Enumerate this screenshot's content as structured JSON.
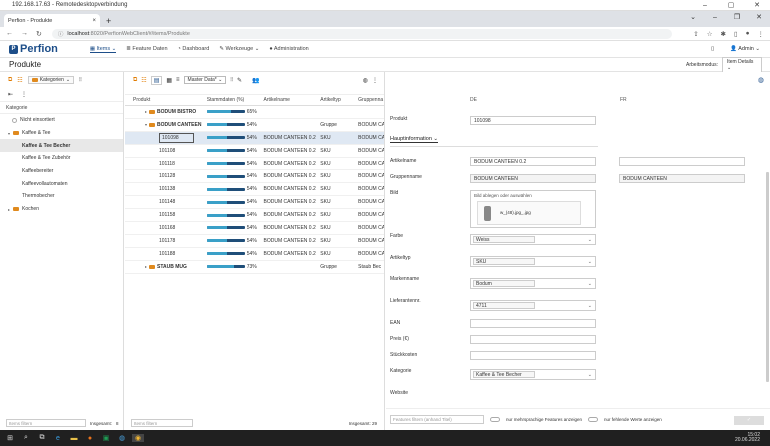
{
  "rdp": {
    "title": "192.168.17.63 - Remotedesktopverbindung"
  },
  "browser": {
    "tab_title": "Perfion - Produkte",
    "url_host": "localhost",
    "url_rest": ":8020/PerfionWebClient/#/items/Produkte"
  },
  "app": {
    "logo": "Perfion",
    "nav": [
      "Items",
      "Feature Daten",
      "Dashboard",
      "Werkzeuge",
      "Administration"
    ],
    "admin": "Admin"
  },
  "page": {
    "title": "Produkte",
    "mode_label": "Arbeitsmodus:",
    "mode_value": "Item Details"
  },
  "left": {
    "kategorien": "Kategorien",
    "header": "Kategorie",
    "tree": [
      {
        "label": "Nicht einsortiert",
        "level": 0,
        "kind": "none"
      },
      {
        "label": "Kaffee & Tee",
        "level": 0,
        "kind": "folder-open"
      },
      {
        "label": "Kaffee & Tee Becher",
        "level": 1,
        "kind": "leaf",
        "selected": true
      },
      {
        "label": "Kaffee & Tee Zubehör",
        "level": 1,
        "kind": "leaf"
      },
      {
        "label": "Kaffeebereiter",
        "level": 1,
        "kind": "leaf"
      },
      {
        "label": "Kaffeevollautomaten",
        "level": 1,
        "kind": "leaf"
      },
      {
        "label": "Thermobecher",
        "level": 1,
        "kind": "leaf"
      },
      {
        "label": "Kochen",
        "level": 0,
        "kind": "folder"
      }
    ],
    "filter_placeholder": "Items filtern",
    "count_label": "Insgesamt:",
    "count_value": "8"
  },
  "mid": {
    "view": "Master Data*",
    "headers": [
      "Produkt",
      "Stammdaten (%)",
      "Artikelname",
      "Artikeltyp",
      "Gruppenna"
    ],
    "rows": [
      {
        "name": "BODUM BISTRO",
        "pct": 65,
        "pct_label": "65%",
        "artikel": "",
        "typ": "",
        "gruppe": "",
        "kind": "group"
      },
      {
        "name": "BODUM CANTEEN",
        "pct": 54,
        "pct_label": "54%",
        "artikel": "",
        "typ": "Gruppe",
        "gruppe": "BODUM CA",
        "kind": "group-open"
      },
      {
        "name": "101098",
        "pct": 54,
        "pct_label": "54%",
        "artikel": "BODUM CANTEEN 0.2",
        "typ": "SKU",
        "gruppe": "BODUM CA",
        "kind": "item",
        "selected": true
      },
      {
        "name": "101108",
        "pct": 54,
        "pct_label": "54%",
        "artikel": "BODUM CANTEEN 0.2",
        "typ": "SKU",
        "gruppe": "BODUM CA",
        "kind": "item"
      },
      {
        "name": "101118",
        "pct": 54,
        "pct_label": "54%",
        "artikel": "BODUM CANTEEN 0.2",
        "typ": "SKU",
        "gruppe": "BODUM CA",
        "kind": "item"
      },
      {
        "name": "101128",
        "pct": 54,
        "pct_label": "54%",
        "artikel": "BODUM CANTEEN 0.2",
        "typ": "SKU",
        "gruppe": "BODUM CA",
        "kind": "item"
      },
      {
        "name": "101138",
        "pct": 54,
        "pct_label": "54%",
        "artikel": "BODUM CANTEEN 0.2",
        "typ": "SKU",
        "gruppe": "BODUM CA",
        "kind": "item"
      },
      {
        "name": "101148",
        "pct": 54,
        "pct_label": "54%",
        "artikel": "BODUM CANTEEN 0.2",
        "typ": "SKU",
        "gruppe": "BODUM CA",
        "kind": "item"
      },
      {
        "name": "101158",
        "pct": 54,
        "pct_label": "54%",
        "artikel": "BODUM CANTEEN 0.2",
        "typ": "SKU",
        "gruppe": "BODUM CA",
        "kind": "item"
      },
      {
        "name": "101168",
        "pct": 54,
        "pct_label": "54%",
        "artikel": "BODUM CANTEEN 0.2",
        "typ": "SKU",
        "gruppe": "BODUM CA",
        "kind": "item"
      },
      {
        "name": "101178",
        "pct": 54,
        "pct_label": "54%",
        "artikel": "BODUM CANTEEN 0.2",
        "typ": "SKU",
        "gruppe": "BODUM CA",
        "kind": "item"
      },
      {
        "name": "101188",
        "pct": 54,
        "pct_label": "54%",
        "artikel": "BODUM CANTEEN 0.2",
        "typ": "SKU",
        "gruppe": "BODUM CA",
        "kind": "item"
      },
      {
        "name": "STAUB MUG",
        "pct": 73,
        "pct_label": "73%",
        "artikel": "",
        "typ": "Gruppe",
        "gruppe": "Staub Bec",
        "kind": "group"
      }
    ],
    "filter_placeholder": "Items filtern",
    "count_label": "Insgesamt:",
    "count_value": "29"
  },
  "detail": {
    "lang_de": "DE",
    "lang_fr": "FR",
    "produkt_label": "Produkt",
    "produkt_value": "101098",
    "section": "Hauptinformation",
    "artikelname_label": "Artikelname",
    "artikelname_de": "BODUM CANTEEN 0.2",
    "artikelname_fr": "",
    "gruppenname_label": "Gruppenname",
    "gruppenname_de": "BODUM CANTEEN",
    "gruppenname_fr": "BODUM CANTEEN",
    "bild_label": "Bild",
    "bild_drop": "Bild ablegen oder auswählen",
    "bild_file": "w_(48).jpg_.jpg",
    "farbe_label": "Farbe",
    "farbe_value": "Weiss",
    "artikeltyp_label": "Artikeltyp",
    "artikeltyp_value": "SKU",
    "marke_label": "Markenname",
    "marke_value": "Bodum",
    "lieferant_label": "Lieferantennr.",
    "lieferant_value": "4711",
    "ean_label": "EAN",
    "preis_label": "Preis (€)",
    "stueck_label": "Stückkosten",
    "kategorie_label": "Kategorie",
    "kategorie_value": "Kaffee & Tee Becher",
    "website_label": "Website",
    "filter_placeholder": "Features filtern (anhand Titel)",
    "toggle1": "nur mehrsprachige Features anzeigen",
    "toggle2": "nur fehlende Werte anzeigen"
  },
  "taskbar": {
    "time": "15:02",
    "date": "20.06.2022"
  }
}
